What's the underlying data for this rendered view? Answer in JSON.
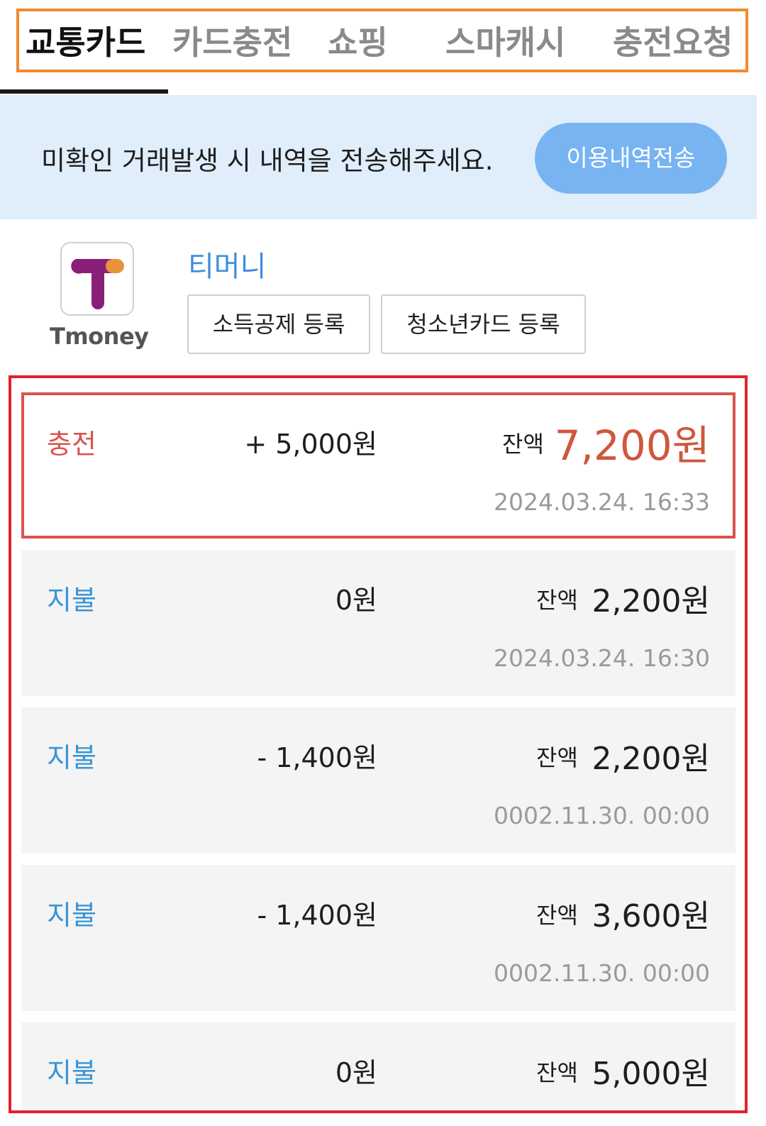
{
  "tabs": [
    "교통카드",
    "카드충전",
    "쇼핑",
    "스마캐시",
    "충전요청"
  ],
  "banner": {
    "message": "미확인 거래발생 시 내역을 전송해주세요.",
    "button_label": "이용내역전송"
  },
  "card": {
    "logo_text": "Tmoney",
    "name": "티머니",
    "buttons": [
      "소득공제 등록",
      "청소년카드 등록"
    ]
  },
  "transactions": [
    {
      "type": "충전",
      "amount": "+ 5,000원",
      "balance_label": "잔액",
      "balance": "7,200원",
      "date": "2024.03.24. 16:33"
    },
    {
      "type": "지불",
      "amount": "0원",
      "balance_label": "잔액",
      "balance": "2,200원",
      "date": "2024.03.24. 16:30"
    },
    {
      "type": "지불",
      "amount": "- 1,400원",
      "balance_label": "잔액",
      "balance": "2,200원",
      "date": "0002.11.30. 00:00"
    },
    {
      "type": "지불",
      "amount": "- 1,400원",
      "balance_label": "잔액",
      "balance": "3,600원",
      "date": "0002.11.30. 00:00"
    },
    {
      "type": "지불",
      "amount": "0원",
      "balance_label": "잔액",
      "balance": "5,000원"
    }
  ],
  "colors": {
    "tab_highlight_border": "#f28a2e",
    "history_frame_border": "#e4202b",
    "charge_text": "#d9534f",
    "pay_text": "#3a95d6",
    "banner_bg": "#e0edfa",
    "banner_button_bg": "#78b4f2",
    "card_name": "#3f8fdd"
  }
}
